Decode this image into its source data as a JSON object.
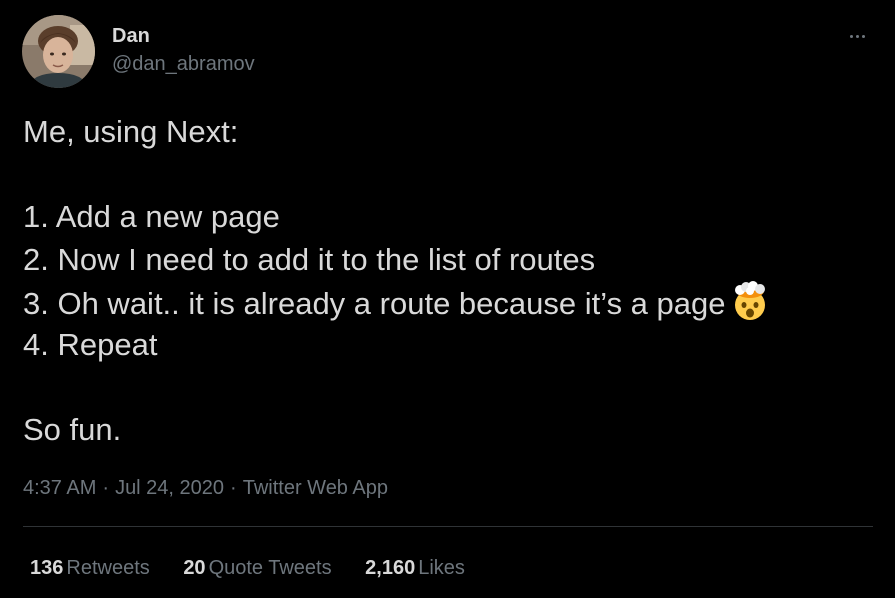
{
  "author": {
    "name": "Dan",
    "handle": "@dan_abramov"
  },
  "tweet": {
    "line1": "Me, using Next:",
    "line2": "1. Add a new page",
    "line3": "2. Now I need to add it to the list of routes",
    "line4": "3. Oh wait.. it is already a route because it’s a page",
    "line4_emoji": "exploding-head-emoji",
    "line5": "4. Repeat",
    "line6": "So fun."
  },
  "meta": {
    "time": "4:37 AM",
    "date": "Jul 24, 2020",
    "source": "Twitter Web App",
    "separator": "·"
  },
  "stats": {
    "retweets_count": "136",
    "retweets_label": "Retweets",
    "quotes_count": "20",
    "quotes_label": "Quote Tweets",
    "likes_count": "2,160",
    "likes_label": "Likes"
  },
  "icons": {
    "more": "more-horizontal-icon"
  },
  "colors": {
    "background": "#000000",
    "text_primary": "#d9d9d9",
    "text_secondary": "#6e767d",
    "divider": "#2f3336"
  }
}
